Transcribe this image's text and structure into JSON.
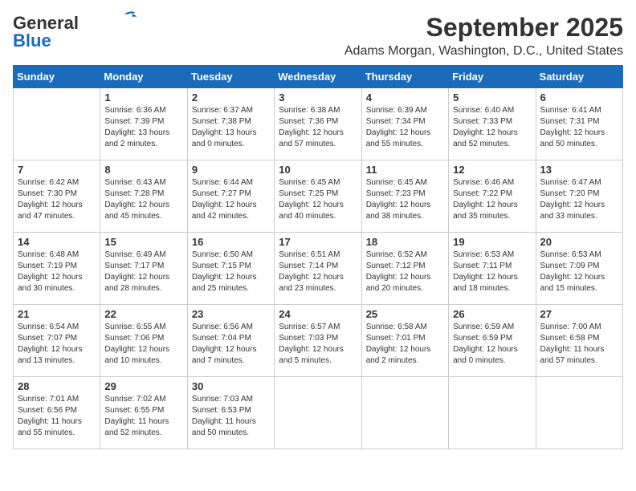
{
  "header": {
    "logo_line1": "General",
    "logo_line2": "Blue",
    "month_title": "September 2025",
    "location": "Adams Morgan, Washington, D.C., United States"
  },
  "days_of_week": [
    "Sunday",
    "Monday",
    "Tuesday",
    "Wednesday",
    "Thursday",
    "Friday",
    "Saturday"
  ],
  "weeks": [
    [
      {
        "day": "",
        "info": ""
      },
      {
        "day": "1",
        "info": "Sunrise: 6:36 AM\nSunset: 7:39 PM\nDaylight: 13 hours\nand 2 minutes."
      },
      {
        "day": "2",
        "info": "Sunrise: 6:37 AM\nSunset: 7:38 PM\nDaylight: 13 hours\nand 0 minutes."
      },
      {
        "day": "3",
        "info": "Sunrise: 6:38 AM\nSunset: 7:36 PM\nDaylight: 12 hours\nand 57 minutes."
      },
      {
        "day": "4",
        "info": "Sunrise: 6:39 AM\nSunset: 7:34 PM\nDaylight: 12 hours\nand 55 minutes."
      },
      {
        "day": "5",
        "info": "Sunrise: 6:40 AM\nSunset: 7:33 PM\nDaylight: 12 hours\nand 52 minutes."
      },
      {
        "day": "6",
        "info": "Sunrise: 6:41 AM\nSunset: 7:31 PM\nDaylight: 12 hours\nand 50 minutes."
      }
    ],
    [
      {
        "day": "7",
        "info": "Sunrise: 6:42 AM\nSunset: 7:30 PM\nDaylight: 12 hours\nand 47 minutes."
      },
      {
        "day": "8",
        "info": "Sunrise: 6:43 AM\nSunset: 7:28 PM\nDaylight: 12 hours\nand 45 minutes."
      },
      {
        "day": "9",
        "info": "Sunrise: 6:44 AM\nSunset: 7:27 PM\nDaylight: 12 hours\nand 42 minutes."
      },
      {
        "day": "10",
        "info": "Sunrise: 6:45 AM\nSunset: 7:25 PM\nDaylight: 12 hours\nand 40 minutes."
      },
      {
        "day": "11",
        "info": "Sunrise: 6:45 AM\nSunset: 7:23 PM\nDaylight: 12 hours\nand 38 minutes."
      },
      {
        "day": "12",
        "info": "Sunrise: 6:46 AM\nSunset: 7:22 PM\nDaylight: 12 hours\nand 35 minutes."
      },
      {
        "day": "13",
        "info": "Sunrise: 6:47 AM\nSunset: 7:20 PM\nDaylight: 12 hours\nand 33 minutes."
      }
    ],
    [
      {
        "day": "14",
        "info": "Sunrise: 6:48 AM\nSunset: 7:19 PM\nDaylight: 12 hours\nand 30 minutes."
      },
      {
        "day": "15",
        "info": "Sunrise: 6:49 AM\nSunset: 7:17 PM\nDaylight: 12 hours\nand 28 minutes."
      },
      {
        "day": "16",
        "info": "Sunrise: 6:50 AM\nSunset: 7:15 PM\nDaylight: 12 hours\nand 25 minutes."
      },
      {
        "day": "17",
        "info": "Sunrise: 6:51 AM\nSunset: 7:14 PM\nDaylight: 12 hours\nand 23 minutes."
      },
      {
        "day": "18",
        "info": "Sunrise: 6:52 AM\nSunset: 7:12 PM\nDaylight: 12 hours\nand 20 minutes."
      },
      {
        "day": "19",
        "info": "Sunrise: 6:53 AM\nSunset: 7:11 PM\nDaylight: 12 hours\nand 18 minutes."
      },
      {
        "day": "20",
        "info": "Sunrise: 6:53 AM\nSunset: 7:09 PM\nDaylight: 12 hours\nand 15 minutes."
      }
    ],
    [
      {
        "day": "21",
        "info": "Sunrise: 6:54 AM\nSunset: 7:07 PM\nDaylight: 12 hours\nand 13 minutes."
      },
      {
        "day": "22",
        "info": "Sunrise: 6:55 AM\nSunset: 7:06 PM\nDaylight: 12 hours\nand 10 minutes."
      },
      {
        "day": "23",
        "info": "Sunrise: 6:56 AM\nSunset: 7:04 PM\nDaylight: 12 hours\nand 7 minutes."
      },
      {
        "day": "24",
        "info": "Sunrise: 6:57 AM\nSunset: 7:03 PM\nDaylight: 12 hours\nand 5 minutes."
      },
      {
        "day": "25",
        "info": "Sunrise: 6:58 AM\nSunset: 7:01 PM\nDaylight: 12 hours\nand 2 minutes."
      },
      {
        "day": "26",
        "info": "Sunrise: 6:59 AM\nSunset: 6:59 PM\nDaylight: 12 hours\nand 0 minutes."
      },
      {
        "day": "27",
        "info": "Sunrise: 7:00 AM\nSunset: 6:58 PM\nDaylight: 11 hours\nand 57 minutes."
      }
    ],
    [
      {
        "day": "28",
        "info": "Sunrise: 7:01 AM\nSunset: 6:56 PM\nDaylight: 11 hours\nand 55 minutes."
      },
      {
        "day": "29",
        "info": "Sunrise: 7:02 AM\nSunset: 6:55 PM\nDaylight: 11 hours\nand 52 minutes."
      },
      {
        "day": "30",
        "info": "Sunrise: 7:03 AM\nSunset: 6:53 PM\nDaylight: 11 hours\nand 50 minutes."
      },
      {
        "day": "",
        "info": ""
      },
      {
        "day": "",
        "info": ""
      },
      {
        "day": "",
        "info": ""
      },
      {
        "day": "",
        "info": ""
      }
    ]
  ]
}
